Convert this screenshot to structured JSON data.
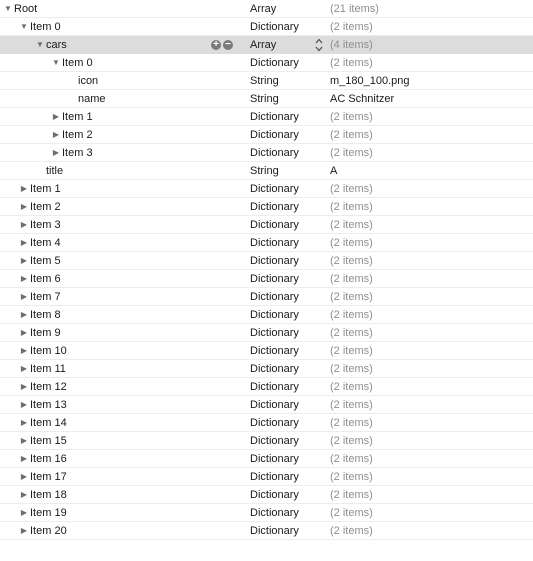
{
  "rows": [
    {
      "key": "Root",
      "type": "Array",
      "value": "(21 items)",
      "depth": 0,
      "arrow": "open"
    },
    {
      "key": "Item 0",
      "type": "Dictionary",
      "value": "(2 items)",
      "depth": 1,
      "arrow": "open"
    },
    {
      "key": "cars",
      "type": "Array",
      "value": "(4 items)",
      "depth": 2,
      "arrow": "open",
      "selected": true
    },
    {
      "key": "Item 0",
      "type": "Dictionary",
      "value": "(2 items)",
      "depth": 3,
      "arrow": "open"
    },
    {
      "key": "icon",
      "type": "String",
      "value": "m_180_100.png",
      "depth": 4,
      "arrow": "none"
    },
    {
      "key": "name",
      "type": "String",
      "value": "AC Schnitzer",
      "depth": 4,
      "arrow": "none"
    },
    {
      "key": "Item 1",
      "type": "Dictionary",
      "value": "(2 items)",
      "depth": 3,
      "arrow": "closed"
    },
    {
      "key": "Item 2",
      "type": "Dictionary",
      "value": "(2 items)",
      "depth": 3,
      "arrow": "closed"
    },
    {
      "key": "Item 3",
      "type": "Dictionary",
      "value": "(2 items)",
      "depth": 3,
      "arrow": "closed"
    },
    {
      "key": "title",
      "type": "String",
      "value": "A",
      "depth": 2,
      "arrow": "none"
    },
    {
      "key": "Item 1",
      "type": "Dictionary",
      "value": "(2 items)",
      "depth": 1,
      "arrow": "closed"
    },
    {
      "key": "Item 2",
      "type": "Dictionary",
      "value": "(2 items)",
      "depth": 1,
      "arrow": "closed"
    },
    {
      "key": "Item 3",
      "type": "Dictionary",
      "value": "(2 items)",
      "depth": 1,
      "arrow": "closed"
    },
    {
      "key": "Item 4",
      "type": "Dictionary",
      "value": "(2 items)",
      "depth": 1,
      "arrow": "closed"
    },
    {
      "key": "Item 5",
      "type": "Dictionary",
      "value": "(2 items)",
      "depth": 1,
      "arrow": "closed"
    },
    {
      "key": "Item 6",
      "type": "Dictionary",
      "value": "(2 items)",
      "depth": 1,
      "arrow": "closed"
    },
    {
      "key": "Item 7",
      "type": "Dictionary",
      "value": "(2 items)",
      "depth": 1,
      "arrow": "closed"
    },
    {
      "key": "Item 8",
      "type": "Dictionary",
      "value": "(2 items)",
      "depth": 1,
      "arrow": "closed"
    },
    {
      "key": "Item 9",
      "type": "Dictionary",
      "value": "(2 items)",
      "depth": 1,
      "arrow": "closed"
    },
    {
      "key": "Item 10",
      "type": "Dictionary",
      "value": "(2 items)",
      "depth": 1,
      "arrow": "closed"
    },
    {
      "key": "Item 11",
      "type": "Dictionary",
      "value": "(2 items)",
      "depth": 1,
      "arrow": "closed"
    },
    {
      "key": "Item 12",
      "type": "Dictionary",
      "value": "(2 items)",
      "depth": 1,
      "arrow": "closed"
    },
    {
      "key": "Item 13",
      "type": "Dictionary",
      "value": "(2 items)",
      "depth": 1,
      "arrow": "closed"
    },
    {
      "key": "Item 14",
      "type": "Dictionary",
      "value": "(2 items)",
      "depth": 1,
      "arrow": "closed"
    },
    {
      "key": "Item 15",
      "type": "Dictionary",
      "value": "(2 items)",
      "depth": 1,
      "arrow": "closed"
    },
    {
      "key": "Item 16",
      "type": "Dictionary",
      "value": "(2 items)",
      "depth": 1,
      "arrow": "closed"
    },
    {
      "key": "Item 17",
      "type": "Dictionary",
      "value": "(2 items)",
      "depth": 1,
      "arrow": "closed"
    },
    {
      "key": "Item 18",
      "type": "Dictionary",
      "value": "(2 items)",
      "depth": 1,
      "arrow": "closed"
    },
    {
      "key": "Item 19",
      "type": "Dictionary",
      "value": "(2 items)",
      "depth": 1,
      "arrow": "closed"
    },
    {
      "key": "Item 20",
      "type": "Dictionary",
      "value": "(2 items)",
      "depth": 1,
      "arrow": "closed"
    }
  ],
  "selected_row_actions": {
    "add_icon": "plus-circle-icon",
    "remove_icon": "minus-circle-icon",
    "type_menu_icon": "up-down-stepper-icon"
  }
}
